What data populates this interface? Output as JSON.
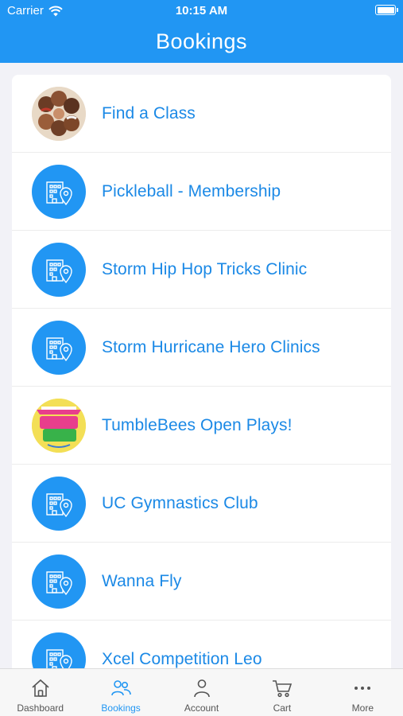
{
  "status_bar": {
    "carrier": "Carrier",
    "time": "10:15 AM"
  },
  "header": {
    "title": "Bookings"
  },
  "list": {
    "items": [
      {
        "label": "Find a Class",
        "icon": "group-photo-icon"
      },
      {
        "label": "Pickleball - Membership",
        "icon": "building-location-icon"
      },
      {
        "label": "Storm Hip Hop Tricks Clinic",
        "icon": "building-location-icon"
      },
      {
        "label": "Storm Hurricane Hero Clinics",
        "icon": "building-location-icon"
      },
      {
        "label": "TumbleBees Open Plays!",
        "icon": "open-play-logo-icon"
      },
      {
        "label": "UC Gymnastics Club",
        "icon": "building-location-icon"
      },
      {
        "label": "Wanna Fly",
        "icon": "building-location-icon"
      },
      {
        "label": "Xcel Competition Leo",
        "icon": "building-location-icon"
      }
    ]
  },
  "tabbar": {
    "tabs": [
      {
        "label": "Dashboard",
        "icon": "home-icon"
      },
      {
        "label": "Bookings",
        "icon": "people-icon",
        "active": true
      },
      {
        "label": "Account",
        "icon": "person-icon"
      },
      {
        "label": "Cart",
        "icon": "cart-icon"
      },
      {
        "label": "More",
        "icon": "more-icon"
      }
    ]
  },
  "colors": {
    "accent": "#2196f3",
    "link": "#1b89e6",
    "background": "#f2f2f7"
  }
}
